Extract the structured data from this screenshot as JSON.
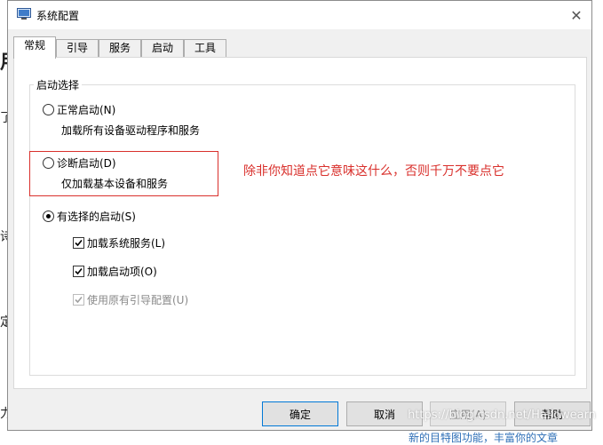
{
  "window": {
    "title": "系统配置",
    "close_glyph": "✕"
  },
  "tabs": [
    {
      "label": "常规",
      "active": true
    },
    {
      "label": "引导",
      "active": false
    },
    {
      "label": "服务",
      "active": false
    },
    {
      "label": "启动",
      "active": false
    },
    {
      "label": "工具",
      "active": false
    }
  ],
  "startup": {
    "group_label": "启动选择",
    "normal": {
      "label": "正常启动(N)",
      "desc": "加载所有设备驱动程序和服务",
      "selected": false
    },
    "diagnostic": {
      "label": "诊断启动(D)",
      "desc": "仅加载基本设备和服务",
      "selected": false
    },
    "selective": {
      "label": "有选择的启动(S)",
      "selected": true,
      "options": {
        "system_services": {
          "label": "加载系统服务(L)",
          "checked": true,
          "disabled": false
        },
        "startup_items": {
          "label": "加载启动项(O)",
          "checked": true,
          "disabled": false
        },
        "original_boot": {
          "label": "使用原有引导配置(U)",
          "checked": true,
          "disabled": true
        }
      }
    }
  },
  "annotation": {
    "text": "除非你知道点它意味这什么，否则千万不要点它",
    "color": "#d9302c"
  },
  "buttons": {
    "ok": "确定",
    "cancel": "取消",
    "apply": "应用(A)",
    "help": "帮助"
  },
  "watermark": "https://blog.csdn.net/Hallowearn",
  "background": {
    "left_fragments": [
      "用",
      "了",
      "诗",
      "定",
      "忐",
      "力"
    ],
    "bottom_text": "新的目特图功能，丰富你的文章"
  },
  "colors": {
    "accent": "#0078d7",
    "annotation": "#d9302c"
  }
}
